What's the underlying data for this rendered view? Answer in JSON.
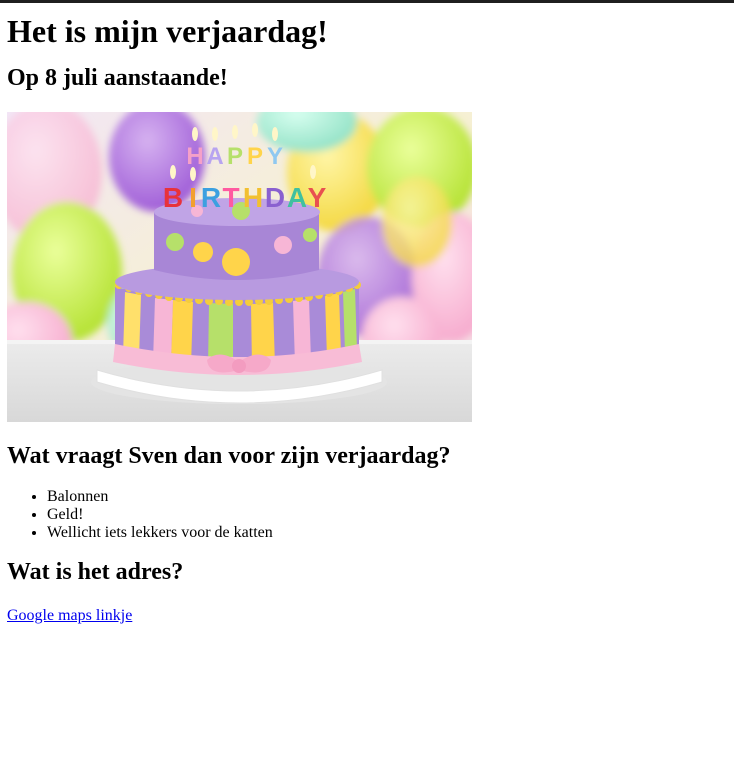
{
  "heading": "Het is mijn verjaardag!",
  "subheading": "Op 8 juli aanstaande!",
  "image": {
    "alt": "Happy birthday cake",
    "candle_text": [
      "HAPPY",
      "BIRTHDAY"
    ]
  },
  "wish_heading": "Wat vraagt Sven dan voor zijn verjaardag?",
  "wishes": [
    "Balonnen",
    "Geld!",
    "Wellicht iets lekkers voor de katten"
  ],
  "address_heading": "Wat is het adres?",
  "map_link": "Google maps linkje",
  "colors": {
    "link": "#0000ee",
    "topbar": "#1f1f1f"
  }
}
